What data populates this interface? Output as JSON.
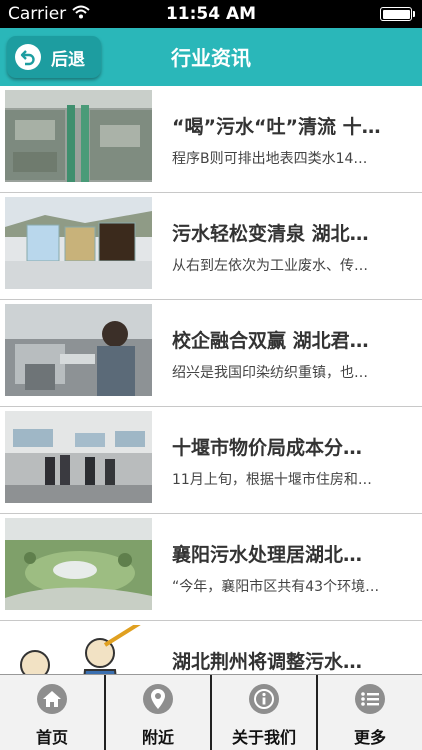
{
  "status_bar": {
    "carrier": "Carrier",
    "time": "11:54 AM"
  },
  "nav": {
    "back_label": "后退",
    "title": "行业资讯"
  },
  "news": [
    {
      "title": "“喝”污水“吐”清流 十…",
      "summary": "程序B则可排出地表四类水14…",
      "thumb": "water-treatment-plant"
    },
    {
      "title": "污水轻松变清泉 湖北…",
      "summary": "从右到左依次为工业废水、传…",
      "thumb": "water-samples"
    },
    {
      "title": "校企融合双赢 湖北君…",
      "summary": "绍兴是我国印染纺织重镇，也…",
      "thumb": "lab-workers"
    },
    {
      "title": "十堰市物价局成本分…",
      "summary": "11月上旬，根据十堰市住房和…",
      "thumb": "inspection-group"
    },
    {
      "title": "襄阳污水处理居湖北…",
      "summary": "“今年，襄阳市区共有43个环境…",
      "thumb": "aerial-park"
    },
    {
      "title": "湖北荆州将调整污水…",
      "summary": "",
      "thumb": "cartoon"
    }
  ],
  "tabs": [
    {
      "label": "首页",
      "icon": "home-icon"
    },
    {
      "label": "附近",
      "icon": "location-pin-icon"
    },
    {
      "label": "关于我们",
      "icon": "info-icon"
    },
    {
      "label": "更多",
      "icon": "list-icon"
    }
  ],
  "colors": {
    "nav": "#2ab7b9",
    "back_button": "#1d9da0",
    "tab_icon": "#8e8e8e"
  }
}
